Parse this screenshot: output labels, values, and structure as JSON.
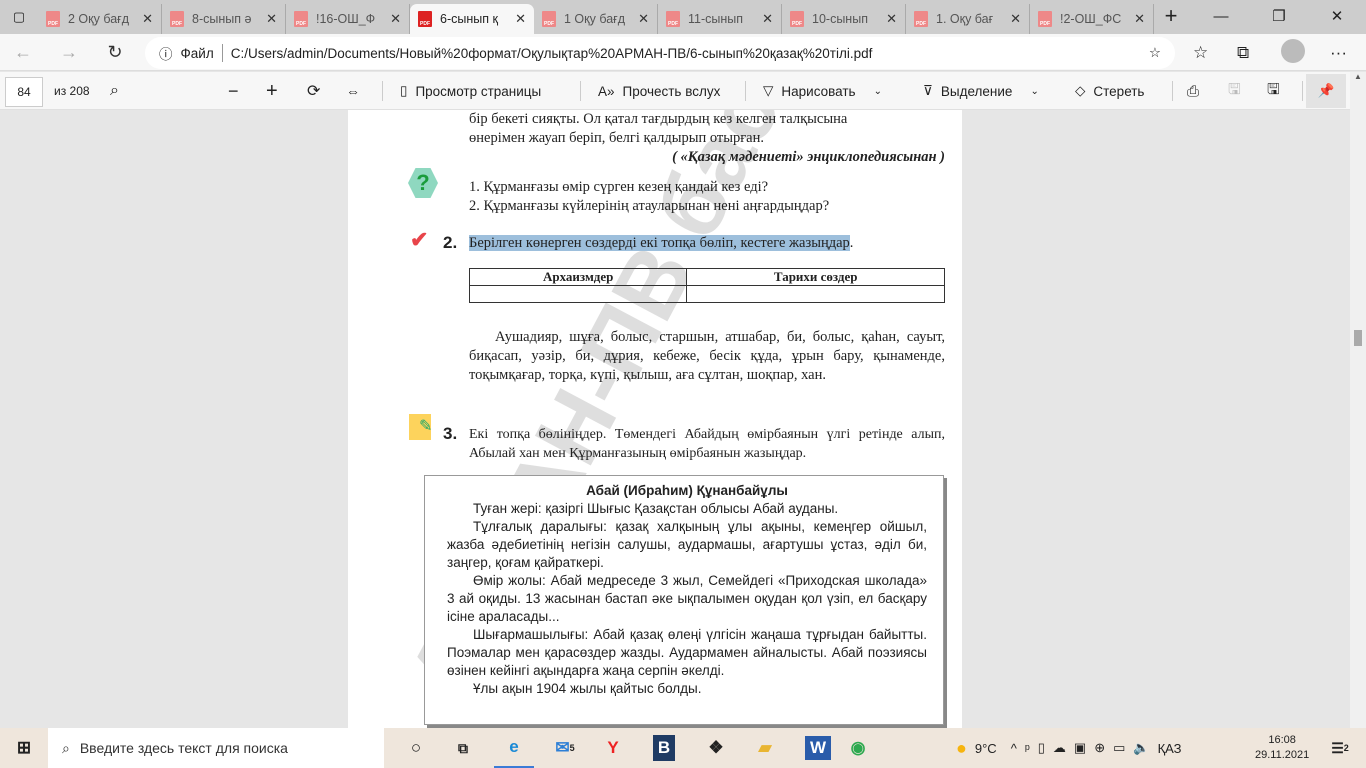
{
  "tabs": [
    {
      "label": "2 Оқу бағд"
    },
    {
      "label": "8-сынып ә"
    },
    {
      "label": "!16-ОШ_Ф"
    },
    {
      "label": "6-сынып қ",
      "active": true
    },
    {
      "label": "1 Оқу бағд"
    },
    {
      "label": "11-сынып"
    },
    {
      "label": "10-сынып"
    },
    {
      "label": "1. Оқу бағ"
    },
    {
      "label": "!2-ОШ_ФС"
    }
  ],
  "address": {
    "scheme_label": "Файл",
    "url": "C:/Users/admin/Documents/Новый%20формат/Оқулықтар%20АРМАН-ПВ/6-сынып%20қазақ%20тілі.pdf"
  },
  "pdf_toolbar": {
    "page": "84",
    "of_pages": "из 208",
    "page_view": "Просмотр страницы",
    "read_aloud": "Прочесть вслух",
    "draw": "Нарисовать",
    "highlight": "Выделение",
    "erase": "Стереть"
  },
  "doc": {
    "top_cut": "бір бекеті сияқты. Ол қатал тағдырдың кез келген талқысына",
    "top_line": "өнерімен жауап беріп, белгі қалдырып отырған.",
    "source": "( «Қазақ мәдениеті» энциклопедиясынан )",
    "questions": [
      "1.  Құрманғазы өмір сүрген кезең қандай кез еді?",
      "2.  Құрманғазы күйлерінің атауларынан нені аңғардыңдар?"
    ],
    "task2_num": "2.",
    "task2": "Берілген көнерген сөздерді екі топқа бөліп, кестеге жазыңдар",
    "table_headers": [
      "Архаизмдер",
      "Тарихи сөздер"
    ],
    "words": "Аушадияр, шұға, болыс, старшын, атшабар, би, болыс, қаһан, сауыт, биқасап, уәзір, би, дұрия, кебеже, бесік құда, ұрын бару, қынаменде, тоқымқағар, торқа, күпі, қылыш, аға сұлтан, шоқпар, хан.",
    "task3_num": "3.",
    "task3": "Екі топқа бөлініңдер. Төмендегі Абайдың өмірбаянын үлгі ретінде алып, Абылай хан мен Құрманғазының өмірбаянын жазыңдар.",
    "box_title": "Абай (Ибраһим) Құнанбайұлы",
    "box_paras": [
      "Туған жері: қазіргі Шығыс Қазақстан облысы Абай ауданы.",
      "Тұлғалық даралығы: қазақ халқының ұлы ақыны, кемеңгер ойшыл, жазба әдебиетінің негізін салушы, аудармашы, ағартушы ұстаз, әділ би, заңгер, қоғам қайраткері.",
      "Өмір жолы: Абай медреседе 3 жыл, Семейдегі «Приходская школада» 3 ай оқиды. 13 жасынан бастап әке ықпалымен оқудан қол үзіп, ел басқару ісіне араласады...",
      "Шығармашылығы: Абай қазақ өлеңі үлгісін жаңаша тұрғыдан байытты. Поэмалар мен қарасөздер жазды. Аудармамен айналысты. Абай поэзиясы өзінен кейінгі ақындарға жаңа серпін әкелді.",
      "Ұлы ақын 1904 жылы қайтыс болды."
    ],
    "watermark": "АРМАН-ПВ баспа"
  },
  "taskbar": {
    "search_placeholder": "Введите здесь текст для поиска",
    "mail_badge": "5",
    "temperature": "9°C",
    "lang": "ҚАЗ",
    "time": "16:08",
    "date": "29.11.2021",
    "notif_count": "2"
  },
  "colors": {
    "highlight": "#9dbfdc",
    "pdf_red": "#d22"
  }
}
